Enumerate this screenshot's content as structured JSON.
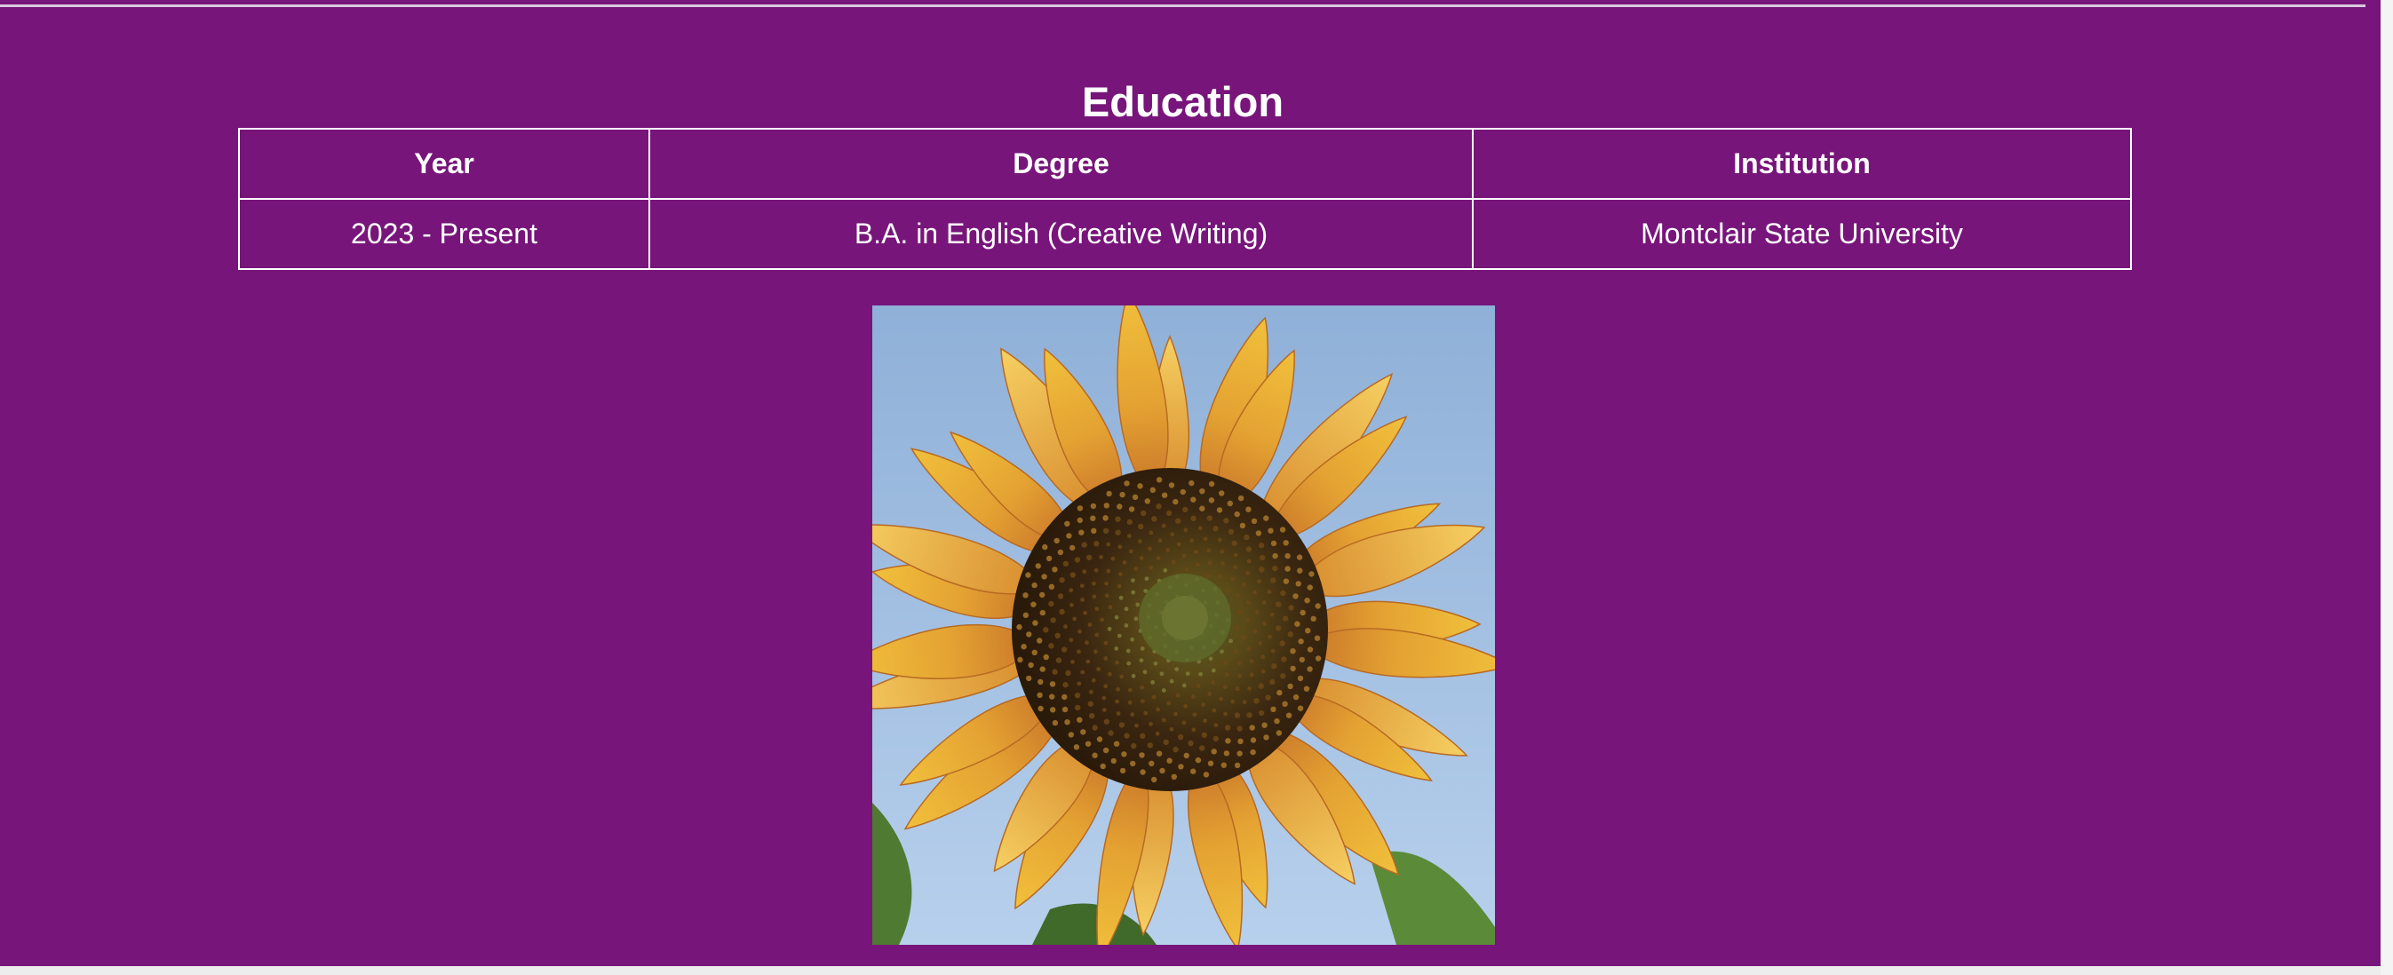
{
  "section": {
    "title": "Education"
  },
  "education_table": {
    "headers": [
      "Year",
      "Degree",
      "Institution"
    ],
    "rows": [
      {
        "year": "2023 - Present",
        "degree": "B.A. in English (Creative Writing)",
        "institution": "Montclair State University"
      }
    ]
  },
  "image": {
    "subject": "sunflower-photo"
  },
  "colors": {
    "background": "#77157a",
    "text": "#ffffff",
    "table_border": "#ffffff",
    "sky": "#9fbfe2",
    "petal": "#e8a72c",
    "seed_head": "#3a2610"
  }
}
